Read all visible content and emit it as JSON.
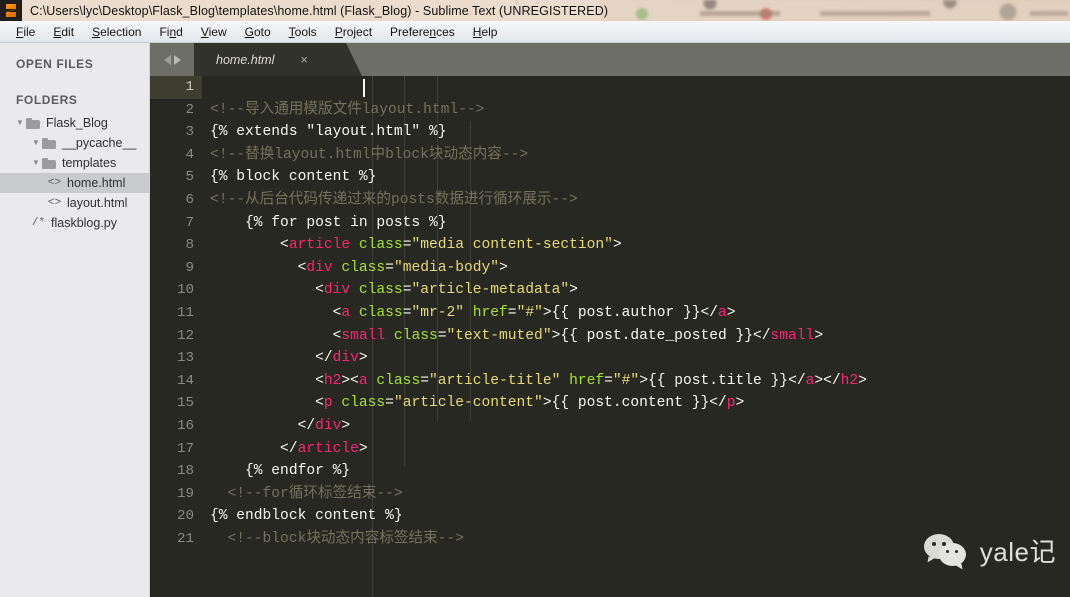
{
  "window": {
    "title": "C:\\Users\\lyc\\Desktop\\Flask_Blog\\templates\\home.html (Flask_Blog) - Sublime Text (UNREGISTERED)",
    "app_icon": "sublime-text-logo"
  },
  "menubar": {
    "items": [
      {
        "label": "File",
        "accel": "F"
      },
      {
        "label": "Edit",
        "accel": "E"
      },
      {
        "label": "Selection",
        "accel": "S"
      },
      {
        "label": "Find",
        "accel": "n"
      },
      {
        "label": "View",
        "accel": "V"
      },
      {
        "label": "Goto",
        "accel": "G"
      },
      {
        "label": "Tools",
        "accel": "T"
      },
      {
        "label": "Project",
        "accel": "P"
      },
      {
        "label": "Preferences",
        "accel": "n"
      },
      {
        "label": "Help",
        "accel": "H"
      }
    ]
  },
  "sidebar": {
    "open_files_header": "OPEN FILES",
    "folders_header": "FOLDERS",
    "tree": [
      {
        "label": "Flask_Blog",
        "type": "folder",
        "depth": 0,
        "expanded": true,
        "selected": false,
        "icon": "folder-icon"
      },
      {
        "label": "__pycache__",
        "type": "folder",
        "depth": 1,
        "expanded": true,
        "selected": false,
        "icon": "folder-icon"
      },
      {
        "label": "templates",
        "type": "folder",
        "depth": 1,
        "expanded": true,
        "selected": false,
        "icon": "folder-icon"
      },
      {
        "label": "home.html",
        "type": "html",
        "depth": 2,
        "expanded": false,
        "selected": true,
        "icon": "html-file-icon",
        "glyph": "<>"
      },
      {
        "label": "layout.html",
        "type": "html",
        "depth": 2,
        "expanded": false,
        "selected": false,
        "icon": "html-file-icon",
        "glyph": "<>"
      },
      {
        "label": "flaskblog.py",
        "type": "python",
        "depth": 1,
        "expanded": false,
        "selected": false,
        "icon": "python-file-icon",
        "glyph": "/*"
      }
    ]
  },
  "tabbar": {
    "nav_back": "nav-back-arrow",
    "nav_forward": "nav-forward-arrow",
    "tabs": [
      {
        "title": "home.html",
        "close": "×",
        "active": true
      }
    ]
  },
  "editor": {
    "active_line": 1,
    "cursor_line": 1,
    "lines": [
      {
        "n": "1",
        "tokens": []
      },
      {
        "n": "2",
        "tokens": [
          {
            "t": "<!--导入通用模版文件layout.html-->",
            "c": "c-com"
          }
        ]
      },
      {
        "n": "3",
        "tokens": [
          {
            "t": "{% extends \"layout.html\" %}",
            "c": "c-pln"
          }
        ]
      },
      {
        "n": "4",
        "tokens": [
          {
            "t": "<!--替换layout.html中block块动态内容-->",
            "c": "c-com"
          }
        ]
      },
      {
        "n": "5",
        "tokens": [
          {
            "t": "{% block content %}",
            "c": "c-pln"
          }
        ]
      },
      {
        "n": "6",
        "tokens": [
          {
            "t": "<!--从后台代码传递过来的posts数据进行循环展示-->",
            "c": "c-com"
          }
        ]
      },
      {
        "n": "7",
        "tokens": [
          {
            "t": "    {% for post in posts %}",
            "c": "c-pln"
          }
        ]
      },
      {
        "n": "8",
        "tokens": [
          {
            "t": "        <",
            "c": "c-pln"
          },
          {
            "t": "article",
            "c": "c-tag"
          },
          {
            "t": " class",
            "c": "c-attr"
          },
          {
            "t": "=",
            "c": "c-pln"
          },
          {
            "t": "\"media content-section\"",
            "c": "c-str"
          },
          {
            "t": ">",
            "c": "c-pln"
          }
        ]
      },
      {
        "n": "9",
        "tokens": [
          {
            "t": "          <",
            "c": "c-pln"
          },
          {
            "t": "div",
            "c": "c-tag"
          },
          {
            "t": " class",
            "c": "c-attr"
          },
          {
            "t": "=",
            "c": "c-pln"
          },
          {
            "t": "\"media-body\"",
            "c": "c-str"
          },
          {
            "t": ">",
            "c": "c-pln"
          }
        ]
      },
      {
        "n": "10",
        "tokens": [
          {
            "t": "            <",
            "c": "c-pln"
          },
          {
            "t": "div",
            "c": "c-tag"
          },
          {
            "t": " class",
            "c": "c-attr"
          },
          {
            "t": "=",
            "c": "c-pln"
          },
          {
            "t": "\"article-metadata\"",
            "c": "c-str"
          },
          {
            "t": ">",
            "c": "c-pln"
          }
        ]
      },
      {
        "n": "11",
        "tokens": [
          {
            "t": "              <",
            "c": "c-pln"
          },
          {
            "t": "a",
            "c": "c-tag"
          },
          {
            "t": " class",
            "c": "c-attr"
          },
          {
            "t": "=",
            "c": "c-pln"
          },
          {
            "t": "\"mr-2\"",
            "c": "c-str"
          },
          {
            "t": " href",
            "c": "c-attr"
          },
          {
            "t": "=",
            "c": "c-pln"
          },
          {
            "t": "\"#\"",
            "c": "c-str"
          },
          {
            "t": ">{{ post.author }}</",
            "c": "c-pln"
          },
          {
            "t": "a",
            "c": "c-tag"
          },
          {
            "t": ">",
            "c": "c-pln"
          }
        ]
      },
      {
        "n": "12",
        "tokens": [
          {
            "t": "              <",
            "c": "c-pln"
          },
          {
            "t": "small",
            "c": "c-tag"
          },
          {
            "t": " class",
            "c": "c-attr"
          },
          {
            "t": "=",
            "c": "c-pln"
          },
          {
            "t": "\"text-muted\"",
            "c": "c-str"
          },
          {
            "t": ">{{ post.date_posted }}</",
            "c": "c-pln"
          },
          {
            "t": "small",
            "c": "c-tag"
          },
          {
            "t": ">",
            "c": "c-pln"
          }
        ]
      },
      {
        "n": "13",
        "tokens": [
          {
            "t": "            </",
            "c": "c-pln"
          },
          {
            "t": "div",
            "c": "c-tag"
          },
          {
            "t": ">",
            "c": "c-pln"
          }
        ]
      },
      {
        "n": "14",
        "tokens": [
          {
            "t": "            <",
            "c": "c-pln"
          },
          {
            "t": "h2",
            "c": "c-tag"
          },
          {
            "t": "><",
            "c": "c-pln"
          },
          {
            "t": "a",
            "c": "c-tag"
          },
          {
            "t": " class",
            "c": "c-attr"
          },
          {
            "t": "=",
            "c": "c-pln"
          },
          {
            "t": "\"article-title\"",
            "c": "c-str"
          },
          {
            "t": " href",
            "c": "c-attr"
          },
          {
            "t": "=",
            "c": "c-pln"
          },
          {
            "t": "\"#\"",
            "c": "c-str"
          },
          {
            "t": ">{{ post.title }}</",
            "c": "c-pln"
          },
          {
            "t": "a",
            "c": "c-tag"
          },
          {
            "t": "></",
            "c": "c-pln"
          },
          {
            "t": "h2",
            "c": "c-tag"
          },
          {
            "t": ">",
            "c": "c-pln"
          }
        ]
      },
      {
        "n": "15",
        "tokens": [
          {
            "t": "            <",
            "c": "c-pln"
          },
          {
            "t": "p",
            "c": "c-tag"
          },
          {
            "t": " class",
            "c": "c-attr"
          },
          {
            "t": "=",
            "c": "c-pln"
          },
          {
            "t": "\"article-content\"",
            "c": "c-str"
          },
          {
            "t": ">{{ post.content }}</",
            "c": "c-pln"
          },
          {
            "t": "p",
            "c": "c-tag"
          },
          {
            "t": ">",
            "c": "c-pln"
          }
        ]
      },
      {
        "n": "16",
        "tokens": [
          {
            "t": "          </",
            "c": "c-pln"
          },
          {
            "t": "div",
            "c": "c-tag"
          },
          {
            "t": ">",
            "c": "c-pln"
          }
        ]
      },
      {
        "n": "17",
        "tokens": [
          {
            "t": "        </",
            "c": "c-pln"
          },
          {
            "t": "article",
            "c": "c-tag"
          },
          {
            "t": ">",
            "c": "c-pln"
          }
        ]
      },
      {
        "n": "18",
        "tokens": [
          {
            "t": "    {% endfor %}",
            "c": "c-pln"
          }
        ]
      },
      {
        "n": "19",
        "tokens": [
          {
            "t": "  <!--for循环标签结束-->",
            "c": "c-com"
          }
        ]
      },
      {
        "n": "20",
        "tokens": [
          {
            "t": "{% endblock content %}",
            "c": "c-pln"
          }
        ]
      },
      {
        "n": "21",
        "tokens": [
          {
            "t": "  <!--block块动态内容标签结束-->",
            "c": "c-com"
          }
        ]
      }
    ]
  },
  "watermark": {
    "logo": "wechat-logo",
    "text": "yale记"
  },
  "colors": {
    "editor_bg": "#272822",
    "tabbar_bg": "#6e6e69",
    "active_tab_bg": "#32322c",
    "sidebar_bg": "#eaeaec",
    "titlebar_bg": "#e8d8c8",
    "comment": "#75715e",
    "tag": "#f92672",
    "attribute": "#a6e22e",
    "string": "#e6db74",
    "plain": "#f8f8f2",
    "active_line_gutter": "#3d3e2f"
  }
}
